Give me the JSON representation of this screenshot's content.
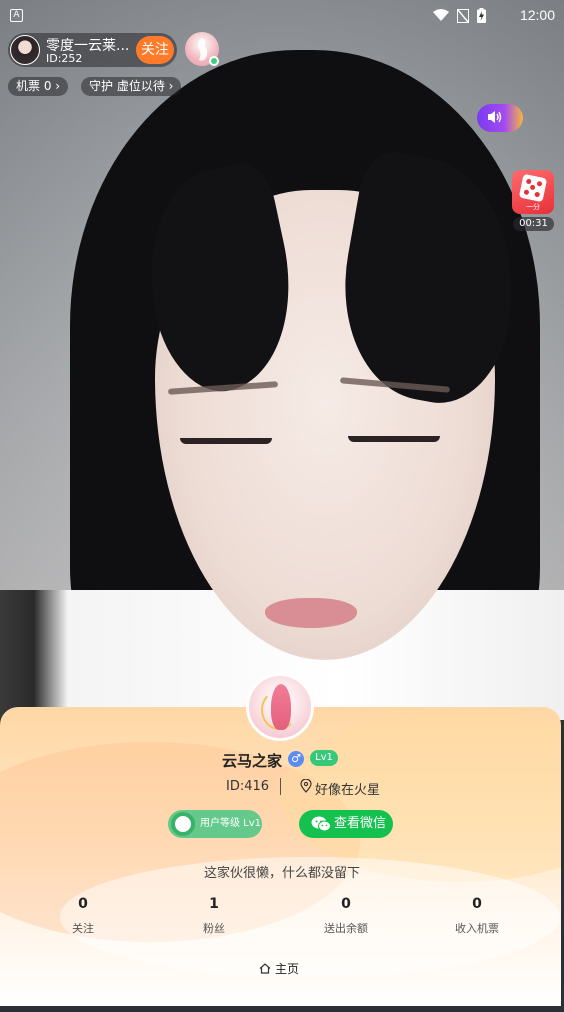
{
  "status_bar": {
    "indicator": "A",
    "time": "12:00",
    "icons": [
      "wifi-icon",
      "no-signal-icon",
      "battery-charging-icon"
    ]
  },
  "host": {
    "name": "零度一云莱...",
    "id": "ID:252",
    "follow_label": "关注"
  },
  "chips": {
    "tickets": "机票  0 ›",
    "guard": "守护  虚位以待 ›"
  },
  "game": {
    "label": "一分",
    "timer": "00:31"
  },
  "profile": {
    "name": "云马之家",
    "gender_symbol": "♂",
    "level": "Lv1",
    "id": "ID:416",
    "location": "好像在火星",
    "user_level_label": "用户等级 Lv1",
    "wechat_label": "查看微信",
    "bio": "这家伙很懒，什么都没留下",
    "stats": [
      {
        "value": "0",
        "label": "关注"
      },
      {
        "value": "1",
        "label": "粉丝"
      },
      {
        "value": "0",
        "label": "送出余额"
      },
      {
        "value": "0",
        "label": "收入机票"
      }
    ],
    "home_tab": "主页"
  },
  "colors": {
    "follow": "#ff7b2a",
    "wechat": "#14c14f",
    "level_badge": "#38c87a",
    "gender": "#5b8cf5"
  }
}
